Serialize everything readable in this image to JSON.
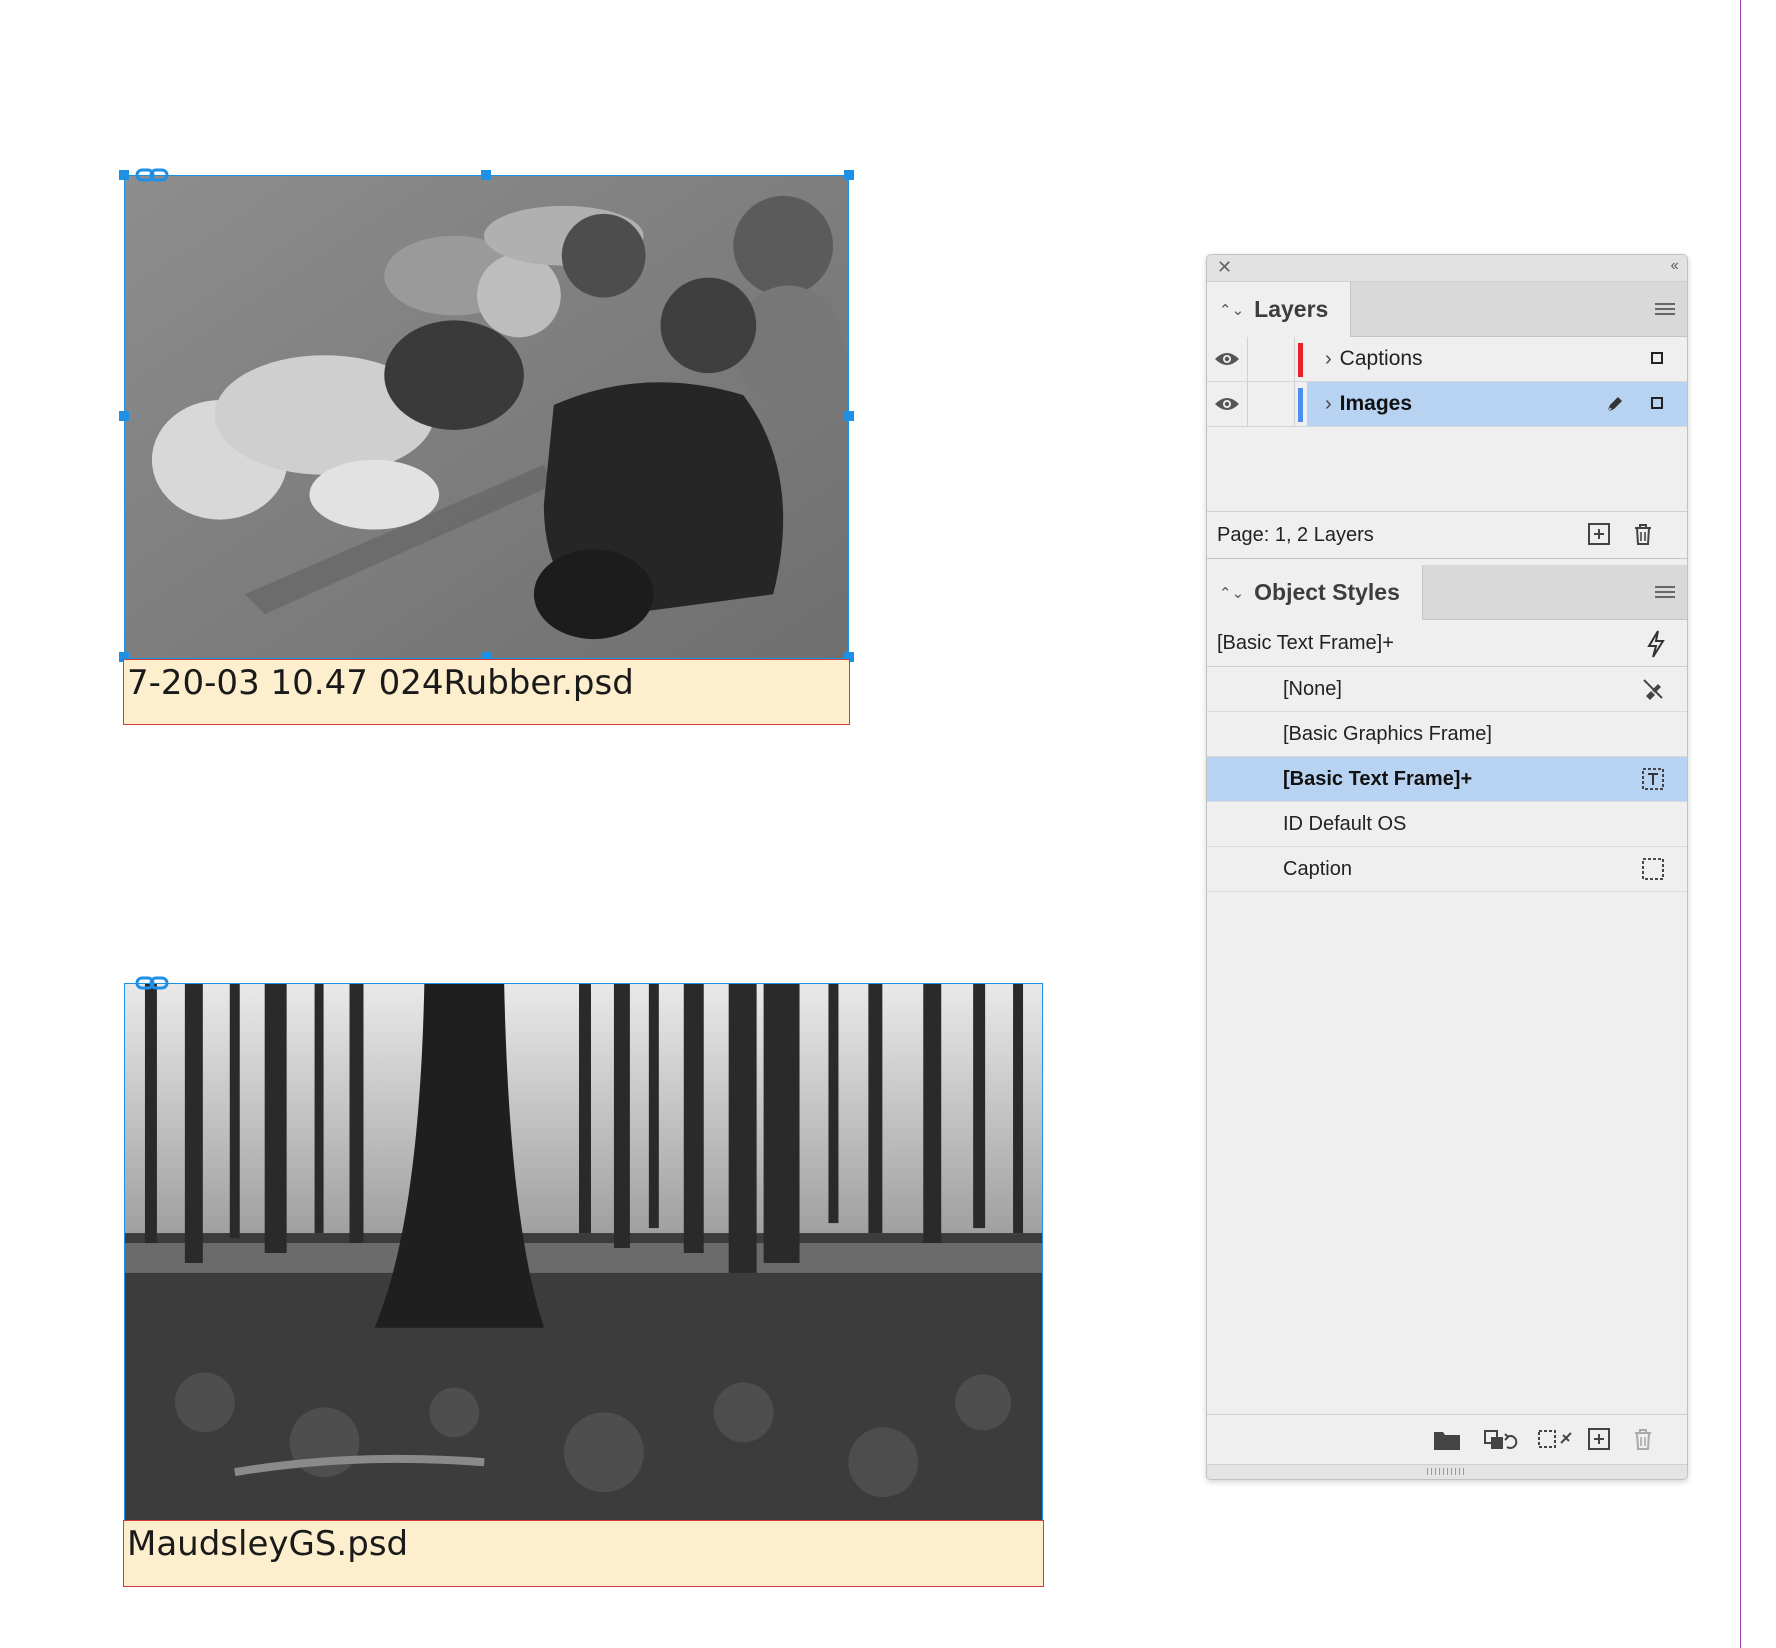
{
  "document": {
    "captions": [
      "7-20-03 10.47 024Rubber.psd",
      "MaudsleyGS.psd"
    ]
  },
  "layers_panel": {
    "tab_label": "Layers",
    "layers": [
      {
        "name": "Captions",
        "color": "#e8222a",
        "visible": true,
        "selected": false
      },
      {
        "name": "Images",
        "color": "#4a8ef0",
        "visible": true,
        "selected": true
      }
    ],
    "footer_text": "Page: 1, 2 Layers"
  },
  "object_styles_panel": {
    "tab_label": "Object Styles",
    "current_style": "[Basic Text Frame]+",
    "styles": [
      {
        "label": "[None]",
        "icon": "none-style-icon"
      },
      {
        "label": "[Basic Graphics Frame]",
        "icon": ""
      },
      {
        "label": "[Basic Text Frame]+",
        "icon": "text-frame-default-icon",
        "selected": true
      },
      {
        "label": "ID Default OS",
        "icon": ""
      },
      {
        "label": "Caption",
        "icon": "graphics-frame-default-icon"
      }
    ]
  },
  "colors": {
    "selection": "#1e90e6",
    "caption_fill": "#fdefcd",
    "caption_border": "#d23b3b",
    "row_highlight": "#b7d3f1"
  }
}
